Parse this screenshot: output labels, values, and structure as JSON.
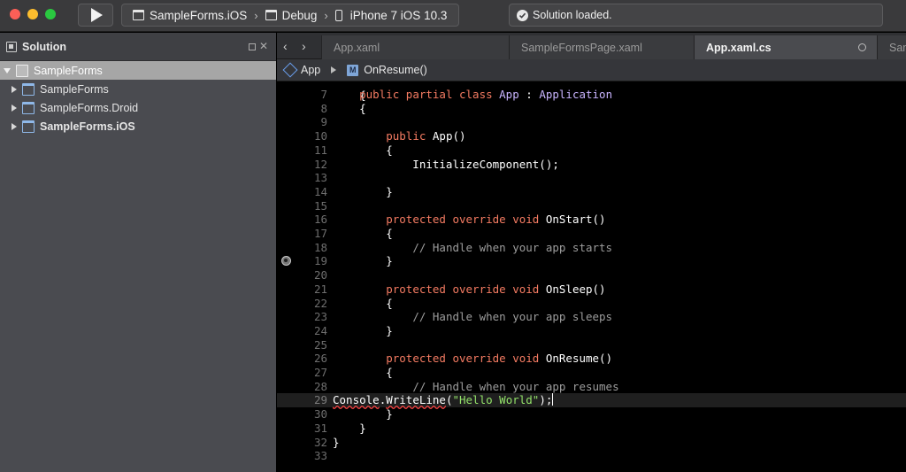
{
  "toolbar": {
    "project": "SampleForms.iOS",
    "configuration": "Debug",
    "device": "iPhone 7 iOS 10.3",
    "status": "Solution loaded."
  },
  "sidebar": {
    "title": "Solution",
    "root": "SampleForms",
    "projects": [
      {
        "label": "SampleForms",
        "bold": false
      },
      {
        "label": "SampleForms.Droid",
        "bold": false
      },
      {
        "label": "SampleForms.iOS",
        "bold": true
      }
    ]
  },
  "tabs": [
    {
      "label": "App.xaml",
      "active": false
    },
    {
      "label": "SampleFormsPage.xaml",
      "active": false
    },
    {
      "label": "App.xaml.cs",
      "active": true
    },
    {
      "label": "Sam",
      "active": false
    }
  ],
  "breadcrumb": {
    "class_name": "App",
    "member_icon": "M",
    "method_name": "OnResume()"
  },
  "editor": {
    "first_line_fragment": "{",
    "current_line": 29,
    "lines": [
      {
        "n": "7",
        "tokens": [
          [
            "",
            "    "
          ],
          [
            "k",
            "public partial class "
          ],
          [
            "t",
            "App"
          ],
          [
            "",
            " : "
          ],
          [
            "t",
            "Application"
          ]
        ]
      },
      {
        "n": "8",
        "tokens": [
          [
            "",
            "    {"
          ]
        ]
      },
      {
        "n": "9",
        "tokens": []
      },
      {
        "n": "10",
        "tokens": [
          [
            "",
            "        "
          ],
          [
            "k",
            "public "
          ],
          [
            "",
            "App()"
          ]
        ]
      },
      {
        "n": "11",
        "tokens": [
          [
            "",
            "        {"
          ]
        ]
      },
      {
        "n": "12",
        "tokens": [
          [
            "",
            "            InitializeComponent();"
          ]
        ]
      },
      {
        "n": "13",
        "tokens": []
      },
      {
        "n": "14",
        "tokens": [
          [
            "",
            "        }"
          ]
        ]
      },
      {
        "n": "15",
        "tokens": []
      },
      {
        "n": "16",
        "tokens": [
          [
            "",
            "        "
          ],
          [
            "k",
            "protected override void "
          ],
          [
            "",
            "OnStart()"
          ]
        ]
      },
      {
        "n": "17",
        "tokens": [
          [
            "",
            "        {"
          ]
        ]
      },
      {
        "n": "18",
        "tokens": [
          [
            "",
            "            "
          ],
          [
            "cm",
            "// Handle when your app starts"
          ]
        ]
      },
      {
        "n": "19",
        "tokens": [
          [
            "",
            "        }"
          ]
        ]
      },
      {
        "n": "20",
        "tokens": []
      },
      {
        "n": "21",
        "tokens": [
          [
            "",
            "        "
          ],
          [
            "k",
            "protected override void "
          ],
          [
            "",
            "OnSleep()"
          ]
        ]
      },
      {
        "n": "22",
        "tokens": [
          [
            "",
            "        {"
          ]
        ]
      },
      {
        "n": "23",
        "tokens": [
          [
            "",
            "            "
          ],
          [
            "cm",
            "// Handle when your app sleeps"
          ]
        ]
      },
      {
        "n": "24",
        "tokens": [
          [
            "",
            "        }"
          ]
        ]
      },
      {
        "n": "25",
        "tokens": []
      },
      {
        "n": "26",
        "tokens": [
          [
            "",
            "        "
          ],
          [
            "k",
            "protected override void "
          ],
          [
            "",
            "OnResume()"
          ]
        ]
      },
      {
        "n": "27",
        "tokens": [
          [
            "",
            "        {"
          ]
        ]
      },
      {
        "n": "28",
        "tokens": [
          [
            "",
            "            "
          ],
          [
            "cm",
            "// Handle when your app resumes"
          ]
        ]
      },
      {
        "n": "29",
        "tokens": [
          [
            "err",
            "Console"
          ],
          [
            "",
            "."
          ],
          [
            "err",
            "WriteLine"
          ],
          [
            "",
            "("
          ],
          [
            "s",
            "\"Hello World\""
          ],
          [
            "",
            ");"
          ]
        ]
      },
      {
        "n": "30",
        "tokens": [
          [
            "",
            "        }"
          ]
        ]
      },
      {
        "n": "31",
        "tokens": [
          [
            "",
            "    }"
          ]
        ]
      },
      {
        "n": "32",
        "tokens": [
          [
            "",
            "}"
          ]
        ]
      },
      {
        "n": "33",
        "tokens": []
      }
    ]
  },
  "colors": {
    "keyword": "#f47b62",
    "type": "#c9b4ff",
    "comment": "#9c9c9c",
    "string": "#94e36a",
    "selection": "#a6a6a6"
  }
}
